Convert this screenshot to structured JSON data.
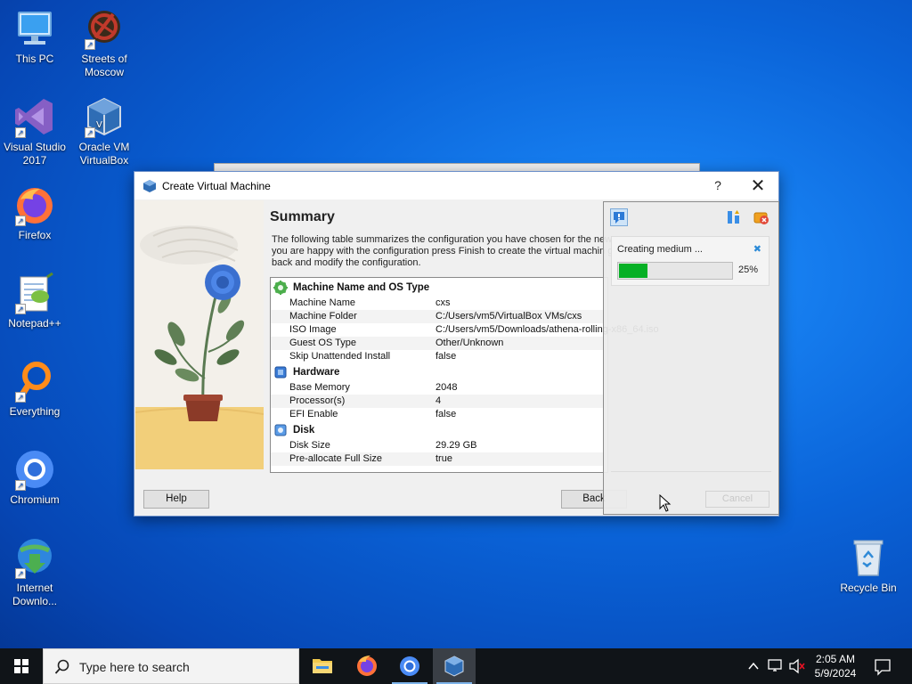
{
  "desktop_icons": [
    {
      "label": "This PC",
      "icon": "pc-icon"
    },
    {
      "label": "Streets of Moscow",
      "icon": "game-icon"
    },
    {
      "label": "Visual Studio 2017",
      "icon": "visual-studio-icon"
    },
    {
      "label": "Oracle VM VirtualBox",
      "icon": "virtualbox-icon"
    },
    {
      "label": "Firefox",
      "icon": "firefox-icon"
    },
    {
      "label": "Notepad++",
      "icon": "notepadpp-icon"
    },
    {
      "label": "Everything",
      "icon": "everything-icon"
    },
    {
      "label": "Chromium",
      "icon": "chromium-icon"
    },
    {
      "label": "Internet Downlo...",
      "icon": "idm-icon"
    },
    {
      "label": "Recycle Bin",
      "icon": "recycle-bin-icon"
    }
  ],
  "dialog": {
    "title": "Create Virtual Machine",
    "help_glyph": "?",
    "close_glyph": "✕",
    "summary_title": "Summary",
    "summary_desc": "The following table summarizes the configuration you have chosen for the new you are happy with the configuration press Finish to create the virtual machin go back and modify the configuration.",
    "sections": [
      {
        "title": "Machine Name and OS Type",
        "rows": [
          {
            "key": "Machine Name",
            "value": "cxs"
          },
          {
            "key": "Machine Folder",
            "value": "C:/Users/vm5/VirtualBox VMs/cxs"
          },
          {
            "key": "ISO Image",
            "value": "C:/Users/vm5/Downloads/athena-rolling-x86_64.iso"
          },
          {
            "key": "Guest OS Type",
            "value": "Other/Unknown"
          },
          {
            "key": "Skip Unattended Install",
            "value": "false"
          }
        ]
      },
      {
        "title": "Hardware",
        "rows": [
          {
            "key": "Base Memory",
            "value": "2048"
          },
          {
            "key": "Processor(s)",
            "value": "4"
          },
          {
            "key": "EFI Enable",
            "value": "false"
          }
        ]
      },
      {
        "title": "Disk",
        "rows": [
          {
            "key": "Disk Size",
            "value": "29.29 GB"
          },
          {
            "key": "Pre-allocate Full Size",
            "value": "true"
          }
        ]
      }
    ],
    "buttons": {
      "help": "Help",
      "back": "Back"
    }
  },
  "progress_panel": {
    "task_label": "Creating medium ...",
    "percent_text": "25%",
    "progress_fraction": 0.25,
    "cancel_label": "Cancel"
  },
  "taskbar": {
    "search_placeholder": "Type here to search",
    "time": "2:05 AM",
    "date": "5/9/2024",
    "apps": [
      "file-explorer-icon",
      "firefox-icon",
      "chromium-icon",
      "virtualbox-icon"
    ]
  },
  "colors": {
    "accent": "#0a63d8",
    "progress": "#06b025",
    "taskbar": "#101418"
  }
}
